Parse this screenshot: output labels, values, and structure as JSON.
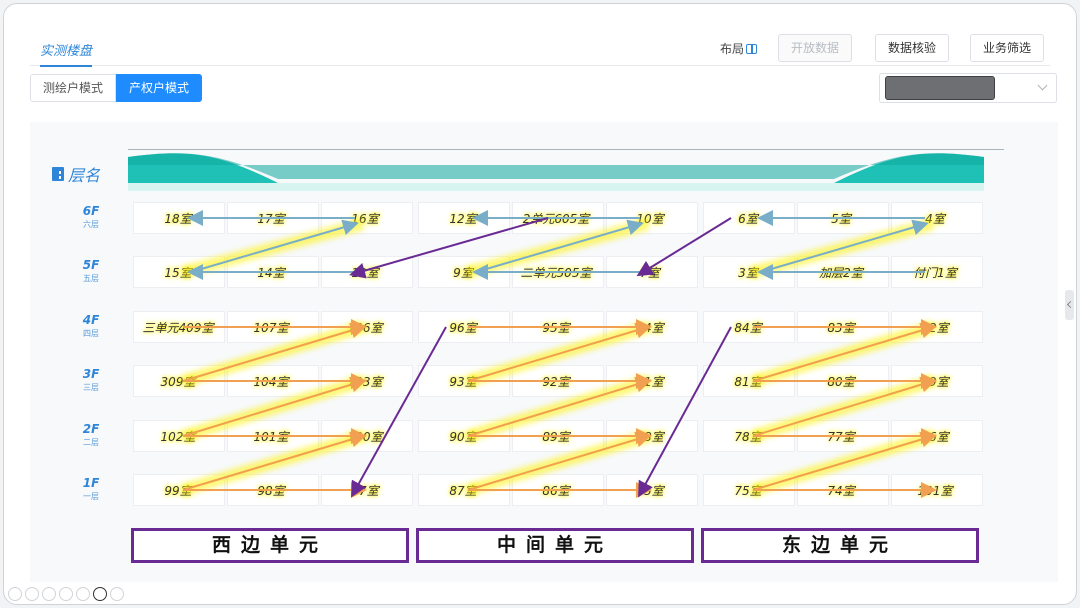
{
  "header": {
    "title_tab": "实测楼盘",
    "layout_label": "布局",
    "buttons": {
      "open_data": "开放数据",
      "data_check": "数据核验",
      "biz_filter": "业务筛选"
    }
  },
  "modes": {
    "survey": "测绘户模式",
    "property": "产权户模式",
    "active": "产权户模式"
  },
  "floor_header": "层名",
  "floors": [
    {
      "en": "6F",
      "cn": "六层"
    },
    {
      "en": "5F",
      "cn": "五层"
    },
    {
      "en": "4F",
      "cn": "四层"
    },
    {
      "en": "3F",
      "cn": "三层"
    },
    {
      "en": "2F",
      "cn": "二层"
    },
    {
      "en": "1F",
      "cn": "一层"
    }
  ],
  "units": [
    {
      "label": "西边单元",
      "rows": [
        [
          "18室",
          "17室",
          "16室"
        ],
        [
          "15室",
          "14室",
          "13室"
        ],
        [
          "三单元409室",
          "107室",
          "106室"
        ],
        [
          "309室",
          "104室",
          "103室"
        ],
        [
          "102室",
          "101室",
          "100室"
        ],
        [
          "99室",
          "98室",
          "97室"
        ]
      ]
    },
    {
      "label": "中间单元",
      "rows": [
        [
          "12室",
          "2单元605室",
          "10室"
        ],
        [
          "9室",
          "二单元505室",
          "7室"
        ],
        [
          "96室",
          "95室",
          "94室"
        ],
        [
          "93室",
          "92室",
          "91室"
        ],
        [
          "90室",
          "89室",
          "88室"
        ],
        [
          "87室",
          "86室",
          "85室"
        ]
      ]
    },
    {
      "label": "东边单元",
      "rows": [
        [
          "6室",
          "5室",
          "4室"
        ],
        [
          "3室",
          "加层2室",
          "付门1室"
        ],
        [
          "84室",
          "83室",
          "82室"
        ],
        [
          "81室",
          "80室",
          "79室"
        ],
        [
          "78室",
          "77室",
          "76室"
        ],
        [
          "75室",
          "74室",
          "101室"
        ]
      ]
    }
  ],
  "colors": {
    "accent": "#1e8cff",
    "upper_path": "#7aaec8",
    "lower_path": "#f0a050",
    "highlight": "#fff200",
    "jump_arrow": "#6a2a93",
    "roof": "#1fc0b6"
  }
}
